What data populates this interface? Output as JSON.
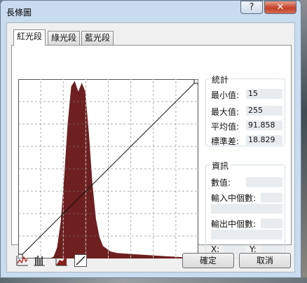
{
  "window": {
    "title": "長條圖",
    "help_label": "?",
    "close_label": "✕"
  },
  "tabs": [
    {
      "label": "紅光段",
      "active": true
    },
    {
      "label": "綠光段",
      "active": false
    },
    {
      "label": "藍光段",
      "active": false
    }
  ],
  "stats": {
    "title": "統計",
    "min_label": "最小值:",
    "min_value": "15",
    "max_label": "最大值:",
    "max_value": "255",
    "mean_label": "平均值:",
    "mean_value": "91.858",
    "std_label": "標準差:",
    "std_value": "18.829"
  },
  "info": {
    "title": "資訊",
    "value_label": "數值:",
    "input_count_label": "輸入中個數:",
    "output_count_label": "輸出中個數:",
    "x_label": "X:",
    "y_label": "Y:"
  },
  "buttons": {
    "ok": "確定",
    "cancel": "取消"
  },
  "toolbar": [
    "histogram-line-icon",
    "histogram-columns-icon",
    "histogram-fill-icon",
    "curve-line-icon"
  ],
  "chart_data": {
    "type": "area",
    "color": "#6e1f1f",
    "x": [
      15,
      25,
      35,
      45,
      50,
      55,
      60,
      65,
      70,
      75,
      80,
      85,
      90,
      95,
      100,
      105,
      110,
      115,
      120,
      130,
      140,
      160,
      180,
      200,
      220,
      240,
      255
    ],
    "y": [
      0,
      0,
      0,
      0,
      0.01,
      0.06,
      0.2,
      0.45,
      0.75,
      0.96,
      0.99,
      0.93,
      0.98,
      0.93,
      0.7,
      0.42,
      0.22,
      0.12,
      0.07,
      0.04,
      0.03,
      0.025,
      0.02,
      0.015,
      0.01,
      0.005,
      0
    ],
    "xlim": [
      0,
      255
    ],
    "ylim": [
      0,
      1
    ],
    "grid": true
  }
}
